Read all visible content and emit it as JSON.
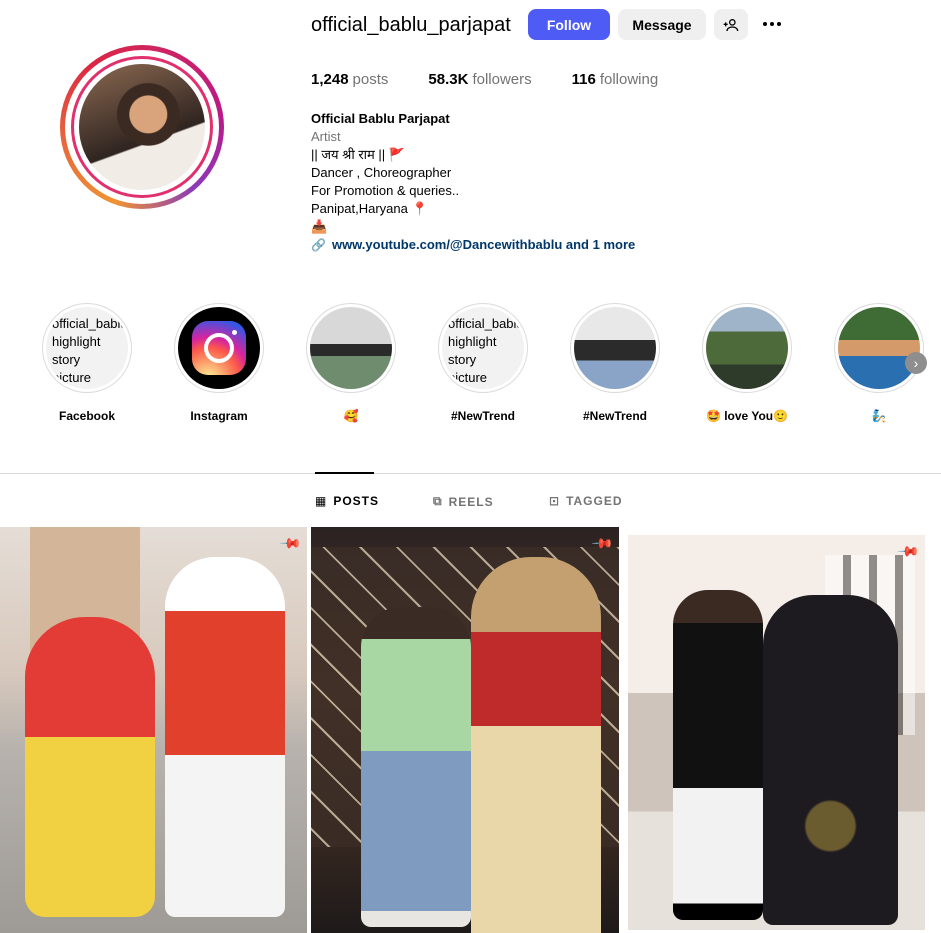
{
  "profile": {
    "username": "official_bablu_parjapat",
    "follow_label": "Follow",
    "message_label": "Message",
    "stats": {
      "posts_count": "1,248",
      "posts_label": "posts",
      "followers_count": "58.3K",
      "followers_label": "followers",
      "following_count": "116",
      "following_label": "following"
    },
    "bio": {
      "name": "Official Bablu Parjapat",
      "category": "Artist",
      "line1": "|| जय श्री राम || 🚩",
      "line2": "Dancer , Choreographer",
      "line3": "For Promotion & queries..",
      "line4": "Panipat,Haryana 📍",
      "line5": "📥",
      "link_text": "www.youtube.com/@Dancewithbablu and 1 more"
    }
  },
  "highlights": [
    {
      "label": "Facebook",
      "text": "official_bablu\nhighlight\nstory\npicture"
    },
    {
      "label": "Instagram"
    },
    {
      "label": "🥰"
    },
    {
      "label": "#NewTrend",
      "text": "official_bablu\nhighlight\nstory\npicture"
    },
    {
      "label": "#NewTrend"
    },
    {
      "label": "🤩 love You🙂"
    },
    {
      "label": "🧞"
    }
  ],
  "tabs": [
    {
      "label": "POSTS",
      "icon": "grid-icon"
    },
    {
      "label": "REELS",
      "icon": "reels-icon"
    },
    {
      "label": "TAGGED",
      "icon": "tagged-icon"
    }
  ],
  "colors": {
    "follow_button": "#4f5bf5",
    "link": "#00376b",
    "muted": "#737373"
  }
}
